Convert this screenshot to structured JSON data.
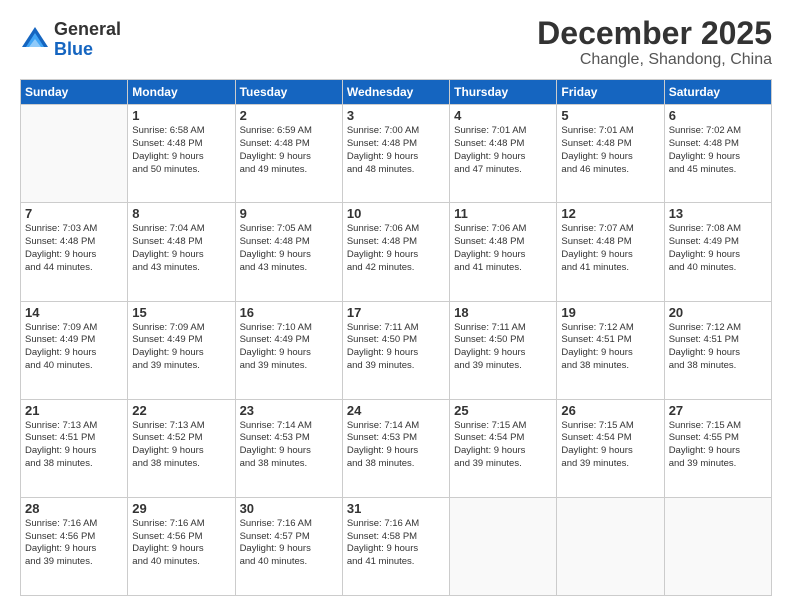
{
  "logo": {
    "general": "General",
    "blue": "Blue"
  },
  "title": "December 2025",
  "subtitle": "Changle, Shandong, China",
  "days": [
    "Sunday",
    "Monday",
    "Tuesday",
    "Wednesday",
    "Thursday",
    "Friday",
    "Saturday"
  ],
  "weeks": [
    [
      {
        "day": "",
        "info": ""
      },
      {
        "day": "1",
        "info": "Sunrise: 6:58 AM\nSunset: 4:48 PM\nDaylight: 9 hours\nand 50 minutes."
      },
      {
        "day": "2",
        "info": "Sunrise: 6:59 AM\nSunset: 4:48 PM\nDaylight: 9 hours\nand 49 minutes."
      },
      {
        "day": "3",
        "info": "Sunrise: 7:00 AM\nSunset: 4:48 PM\nDaylight: 9 hours\nand 48 minutes."
      },
      {
        "day": "4",
        "info": "Sunrise: 7:01 AM\nSunset: 4:48 PM\nDaylight: 9 hours\nand 47 minutes."
      },
      {
        "day": "5",
        "info": "Sunrise: 7:01 AM\nSunset: 4:48 PM\nDaylight: 9 hours\nand 46 minutes."
      },
      {
        "day": "6",
        "info": "Sunrise: 7:02 AM\nSunset: 4:48 PM\nDaylight: 9 hours\nand 45 minutes."
      }
    ],
    [
      {
        "day": "7",
        "info": "Sunrise: 7:03 AM\nSunset: 4:48 PM\nDaylight: 9 hours\nand 44 minutes."
      },
      {
        "day": "8",
        "info": "Sunrise: 7:04 AM\nSunset: 4:48 PM\nDaylight: 9 hours\nand 43 minutes."
      },
      {
        "day": "9",
        "info": "Sunrise: 7:05 AM\nSunset: 4:48 PM\nDaylight: 9 hours\nand 43 minutes."
      },
      {
        "day": "10",
        "info": "Sunrise: 7:06 AM\nSunset: 4:48 PM\nDaylight: 9 hours\nand 42 minutes."
      },
      {
        "day": "11",
        "info": "Sunrise: 7:06 AM\nSunset: 4:48 PM\nDaylight: 9 hours\nand 41 minutes."
      },
      {
        "day": "12",
        "info": "Sunrise: 7:07 AM\nSunset: 4:48 PM\nDaylight: 9 hours\nand 41 minutes."
      },
      {
        "day": "13",
        "info": "Sunrise: 7:08 AM\nSunset: 4:49 PM\nDaylight: 9 hours\nand 40 minutes."
      }
    ],
    [
      {
        "day": "14",
        "info": "Sunrise: 7:09 AM\nSunset: 4:49 PM\nDaylight: 9 hours\nand 40 minutes."
      },
      {
        "day": "15",
        "info": "Sunrise: 7:09 AM\nSunset: 4:49 PM\nDaylight: 9 hours\nand 39 minutes."
      },
      {
        "day": "16",
        "info": "Sunrise: 7:10 AM\nSunset: 4:49 PM\nDaylight: 9 hours\nand 39 minutes."
      },
      {
        "day": "17",
        "info": "Sunrise: 7:11 AM\nSunset: 4:50 PM\nDaylight: 9 hours\nand 39 minutes."
      },
      {
        "day": "18",
        "info": "Sunrise: 7:11 AM\nSunset: 4:50 PM\nDaylight: 9 hours\nand 39 minutes."
      },
      {
        "day": "19",
        "info": "Sunrise: 7:12 AM\nSunset: 4:51 PM\nDaylight: 9 hours\nand 38 minutes."
      },
      {
        "day": "20",
        "info": "Sunrise: 7:12 AM\nSunset: 4:51 PM\nDaylight: 9 hours\nand 38 minutes."
      }
    ],
    [
      {
        "day": "21",
        "info": "Sunrise: 7:13 AM\nSunset: 4:51 PM\nDaylight: 9 hours\nand 38 minutes."
      },
      {
        "day": "22",
        "info": "Sunrise: 7:13 AM\nSunset: 4:52 PM\nDaylight: 9 hours\nand 38 minutes."
      },
      {
        "day": "23",
        "info": "Sunrise: 7:14 AM\nSunset: 4:53 PM\nDaylight: 9 hours\nand 38 minutes."
      },
      {
        "day": "24",
        "info": "Sunrise: 7:14 AM\nSunset: 4:53 PM\nDaylight: 9 hours\nand 38 minutes."
      },
      {
        "day": "25",
        "info": "Sunrise: 7:15 AM\nSunset: 4:54 PM\nDaylight: 9 hours\nand 39 minutes."
      },
      {
        "day": "26",
        "info": "Sunrise: 7:15 AM\nSunset: 4:54 PM\nDaylight: 9 hours\nand 39 minutes."
      },
      {
        "day": "27",
        "info": "Sunrise: 7:15 AM\nSunset: 4:55 PM\nDaylight: 9 hours\nand 39 minutes."
      }
    ],
    [
      {
        "day": "28",
        "info": "Sunrise: 7:16 AM\nSunset: 4:56 PM\nDaylight: 9 hours\nand 39 minutes."
      },
      {
        "day": "29",
        "info": "Sunrise: 7:16 AM\nSunset: 4:56 PM\nDaylight: 9 hours\nand 40 minutes."
      },
      {
        "day": "30",
        "info": "Sunrise: 7:16 AM\nSunset: 4:57 PM\nDaylight: 9 hours\nand 40 minutes."
      },
      {
        "day": "31",
        "info": "Sunrise: 7:16 AM\nSunset: 4:58 PM\nDaylight: 9 hours\nand 41 minutes."
      },
      {
        "day": "",
        "info": ""
      },
      {
        "day": "",
        "info": ""
      },
      {
        "day": "",
        "info": ""
      }
    ]
  ]
}
